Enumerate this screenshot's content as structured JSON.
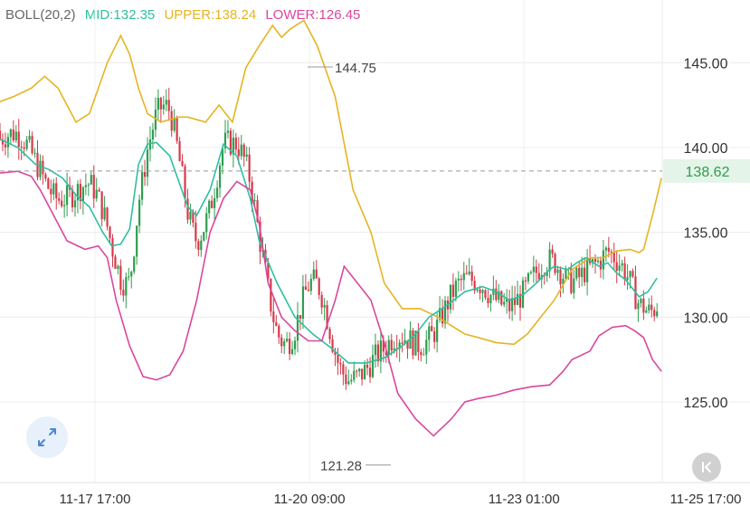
{
  "indicator": {
    "name": "BOLL(20,2)",
    "mid_label": "MID:132.35",
    "upper_label": "UPPER:138.24",
    "lower_label": "LOWER:126.45"
  },
  "colors": {
    "name": "#666666",
    "mid": "#2fbfa0",
    "upper": "#e6b422",
    "lower": "#d9479d",
    "up_candle": "#2e9e4f",
    "down_candle": "#d63a4a",
    "current_price_bg": "#e4f4e8",
    "current_price_text": "#2e9e4f"
  },
  "icons": {
    "expand": "expand-arrows-icon",
    "back": "back-to-latest-icon"
  },
  "chart_data": {
    "type": "candlestick",
    "y_ticks": [
      "145.00",
      "140.00",
      "135.00",
      "130.00",
      "125.00"
    ],
    "x_ticks": [
      "11-17 17:00",
      "11-20 09:00",
      "11-23 01:00",
      "11-25 17:00"
    ],
    "current_price": "138.62",
    "high_annotation": "144.75",
    "low_annotation": "121.28",
    "y_range": [
      120.3,
      148.7
    ],
    "x_range": [
      0,
      175
    ],
    "x_tick_positions": [
      0,
      64,
      128,
      192
    ],
    "mid": [
      [
        0,
        140.5
      ],
      [
        8,
        140
      ],
      [
        16,
        139
      ],
      [
        22,
        138.7
      ],
      [
        28,
        138.2
      ],
      [
        34,
        137.2
      ],
      [
        40,
        136.5
      ],
      [
        46,
        135
      ],
      [
        50,
        134.2
      ],
      [
        54,
        134.3
      ],
      [
        58,
        135.2
      ],
      [
        62,
        139
      ],
      [
        66,
        140.2
      ],
      [
        70,
        140.3
      ],
      [
        76,
        139.5
      ],
      [
        80,
        138
      ],
      [
        84,
        136.5
      ],
      [
        88,
        136
      ],
      [
        94,
        137.5
      ],
      [
        100,
        140.2
      ],
      [
        106,
        139.5
      ],
      [
        112,
        137
      ],
      [
        116,
        134.5
      ],
      [
        124,
        132
      ],
      [
        132,
        130
      ],
      [
        140,
        129
      ],
      [
        148,
        128.2
      ],
      [
        156,
        127.3
      ],
      [
        164,
        127.3
      ],
      [
        172,
        127.6
      ],
      [
        180,
        128.3
      ],
      [
        186,
        129
      ],
      [
        192,
        130
      ],
      [
        200,
        130.7
      ],
      [
        208,
        131.5
      ],
      [
        216,
        131.8
      ],
      [
        222,
        131.5
      ],
      [
        228,
        131
      ],
      [
        234,
        131.3
      ],
      [
        240,
        132
      ],
      [
        245,
        132.7
      ],
      [
        248,
        133
      ],
      [
        254,
        132.8
      ],
      [
        258,
        133.2
      ],
      [
        262,
        133.5
      ],
      [
        268,
        133
      ],
      [
        272,
        133.2
      ],
      [
        276,
        132.6
      ],
      [
        280,
        132.2
      ],
      [
        286,
        131.2
      ],
      [
        290,
        131.5
      ],
      [
        294,
        132.3
      ]
    ],
    "upper": [
      [
        0,
        142.7
      ],
      [
        6,
        143
      ],
      [
        14,
        143.5
      ],
      [
        20,
        144.2
      ],
      [
        26,
        143.5
      ],
      [
        34,
        141.5
      ],
      [
        40,
        142
      ],
      [
        48,
        145
      ],
      [
        54,
        146.6
      ],
      [
        58,
        145.5
      ],
      [
        62,
        143.5
      ],
      [
        66,
        142
      ],
      [
        72,
        141.5
      ],
      [
        80,
        141.8
      ],
      [
        84,
        141.8
      ],
      [
        92,
        141.5
      ],
      [
        98,
        142.5
      ],
      [
        104,
        141.5
      ],
      [
        110,
        144.7
      ],
      [
        116,
        146
      ],
      [
        122,
        147.2
      ],
      [
        126,
        146.5
      ],
      [
        130,
        147
      ],
      [
        136,
        147.5
      ],
      [
        142,
        146
      ],
      [
        150,
        143
      ],
      [
        158,
        137.5
      ],
      [
        166,
        135
      ],
      [
        172,
        132
      ],
      [
        180,
        130.5
      ],
      [
        188,
        130.5
      ],
      [
        196,
        130
      ],
      [
        202,
        129.5
      ],
      [
        208,
        129
      ],
      [
        214,
        128.8
      ],
      [
        222,
        128.5
      ],
      [
        230,
        128.4
      ],
      [
        236,
        129
      ],
      [
        242,
        130
      ],
      [
        248,
        131
      ],
      [
        256,
        132.8
      ],
      [
        264,
        133.5
      ],
      [
        270,
        133.5
      ],
      [
        276,
        133.9
      ],
      [
        282,
        134
      ],
      [
        286,
        133.8
      ],
      [
        288,
        134
      ],
      [
        292,
        136
      ],
      [
        296,
        138.2
      ]
    ],
    "lower": [
      [
        0,
        138.5
      ],
      [
        8,
        138.6
      ],
      [
        14,
        138.3
      ],
      [
        18,
        137.5
      ],
      [
        24,
        136
      ],
      [
        30,
        134.5
      ],
      [
        38,
        134
      ],
      [
        44,
        134.2
      ],
      [
        48,
        133.5
      ],
      [
        52,
        131
      ],
      [
        58,
        128.3
      ],
      [
        64,
        126.5
      ],
      [
        70,
        126.3
      ],
      [
        76,
        126.6
      ],
      [
        82,
        128
      ],
      [
        88,
        131
      ],
      [
        94,
        135
      ],
      [
        100,
        137
      ],
      [
        106,
        138
      ],
      [
        112,
        137.5
      ],
      [
        116,
        135.5
      ],
      [
        120,
        132
      ],
      [
        126,
        130
      ],
      [
        132,
        129.2
      ],
      [
        138,
        128.6
      ],
      [
        144,
        128.6
      ],
      [
        150,
        131
      ],
      [
        154,
        133
      ],
      [
        160,
        132
      ],
      [
        166,
        131
      ],
      [
        172,
        128.5
      ],
      [
        178,
        125.5
      ],
      [
        186,
        124
      ],
      [
        194,
        123
      ],
      [
        202,
        124
      ],
      [
        208,
        125
      ],
      [
        214,
        125.2
      ],
      [
        222,
        125.4
      ],
      [
        230,
        125.7
      ],
      [
        238,
        125.9
      ],
      [
        246,
        126
      ],
      [
        252,
        126.8
      ],
      [
        256,
        127.5
      ],
      [
        264,
        128
      ],
      [
        268,
        128.9
      ],
      [
        274,
        129.4
      ],
      [
        280,
        129.5
      ],
      [
        284,
        129.2
      ],
      [
        288,
        128.8
      ],
      [
        292,
        127.5
      ],
      [
        296,
        126.8
      ]
    ]
  }
}
